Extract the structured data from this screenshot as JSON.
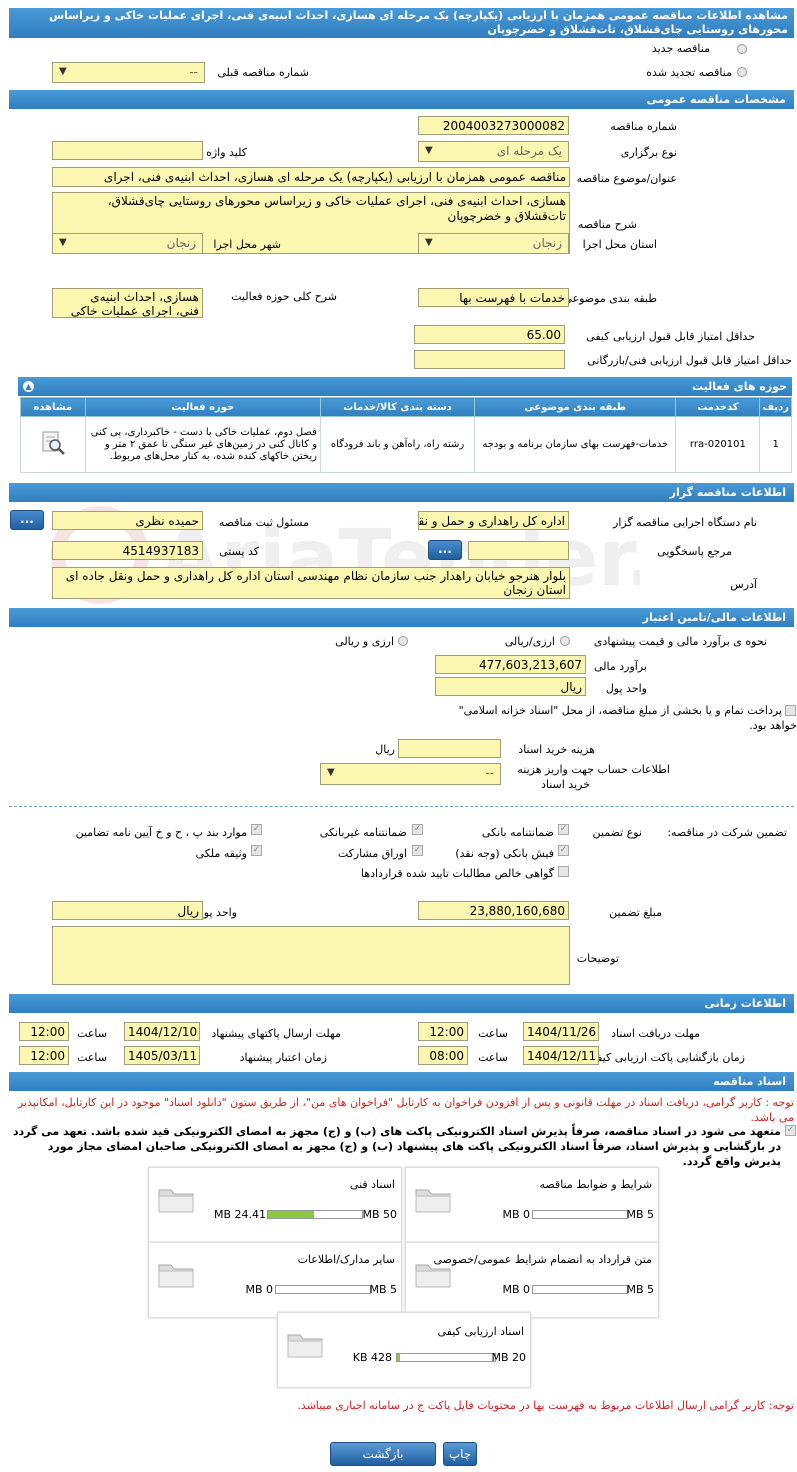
{
  "header": {
    "title_line1": "مشاهده اطلاعات مناقصه عمومی همزمان با ارزیابی (یکپارچه) یک مرحله ای هسازی، احداث ابنیه‌ی فنی، اجرای عملیات خاکی و زیراساس",
    "title_line2": "محورهای روستایی چای‌قشلاق، تات‌قشلاق و خضرچوپان"
  },
  "top": {
    "new_tender": "مناقصه جدید",
    "renewed_tender": "مناقصه تجدید شده",
    "prev_tender_label": "شماره مناقصه قبلی",
    "prev_tender_value": "--"
  },
  "general": {
    "section_title": "مشخصات مناقصه عمومی",
    "number_label": "شماره مناقصه",
    "number_value": "2004003273000082",
    "type_label": "نوع برگزاری",
    "type_value": "یک مرحله ای",
    "keyword_label": "کلید واژه",
    "keyword_value": "",
    "subject_label": "عنوان/موضوع مناقصه",
    "subject_value": "مناقصه عمومی همزمان با ارزیابی (یکپارچه) یک مرحله ای هسازی، احداث ابنیه‌ی فنی، اجرای",
    "desc_label": "شرح مناقصه",
    "desc_value": "هسازی، احداث ابنیه‌ی فنی، اجرای عملیات خاکی و زیراساس محورهای روستایی چای‌قشلاق، تات‌قشلاق و خضرچوپان",
    "province_label": "استان محل اجرا",
    "province_value": "زنجان",
    "city_label": "شهر محل اجرا",
    "city_value": "زنجان",
    "category_label": "طبقه بندی موضوعی",
    "category_value": "خدمات با فهرست بها",
    "scope_label": "شرح کلی حوزه فعالیت",
    "scope_value": "هسازی، احداث ابنیه‌ی فنی، اجرای عملیات خاکی",
    "min_quality_label": "حداقل امتیاز قابل قبول ارزیابی کیفی",
    "min_quality_value": "65.00",
    "min_tech_label": "حداقل امتیاز قابل قبول ارزیابی فنی/بازرگانی",
    "min_tech_value": ""
  },
  "activities": {
    "section_title": "حوزه های فعالیت",
    "columns": [
      "ردیف",
      "کدخدمت",
      "طبقه بندی موضوعی",
      "دسته بندی کالا/خدمات",
      "حوزه فعالیت",
      "مشاهده"
    ],
    "rows": [
      {
        "row": "1",
        "code": "rra-020101",
        "category": "خدمات-فهرست بهای سازمان برنامه و بودجه",
        "group": "رشته راه، راه‌آهن و باند فرودگاه",
        "activity": "فصل دوم، عملیات خاکی با دست - خاکبرداری، پی کنی و کانال کنی در زمین‌های غیر سنگی تا عمق ۲ متر و ریختن خاکهای کنده شده، به کنار محل‌های مربوط."
      }
    ]
  },
  "organizer": {
    "section_title": "اطلاعات مناقصه گزار",
    "org_label": "نام دستگاه اجرایی مناقصه گزار",
    "org_value": "اداره کل راهداری و حمل و نقل",
    "officer_label": "مسئول ثبت مناقصه",
    "officer_value": "حمیده نظری",
    "ref_label": "مرجع پاسخگویی",
    "ref_value": "",
    "postal_label": "کد پستی",
    "postal_value": "4514937183",
    "address_label": "آدرس",
    "address_value": "بلوار هنرجو خیابان راهدار جنب سازمان نظام مهندسی استان اداره کل راهداری و حمل ونقل جاده ای استان زنجان",
    "dots": "..."
  },
  "finance": {
    "section_title": "اطلاعات مالی/تامین اعتبار",
    "method_label": "نحوه ی برآورد مالی و قیمت پیشنهادی",
    "opt1": "ارزی/ریالی",
    "opt2": "ارزی و ریالی",
    "estimate_label": "برآورد مالی",
    "estimate_value": "477,603,213,607",
    "currency_label": "واحد پول",
    "currency_value": "ریال",
    "treasury_text1": "پرداخت تمام و یا بخشی از مبلغ مناقصه، از محل \"اسناد خزانه اسلامی\"",
    "treasury_text2": "خواهد بود.",
    "doc_cost_label": "هزینه خرید اسناد",
    "doc_cost_value": "",
    "doc_cost_unit": "ریال",
    "account_label1": "اطلاعات حساب جهت واریز هزینه",
    "account_label2": "خرید اسناد",
    "account_value": "--"
  },
  "guarantee": {
    "label": "تضمین شرکت در مناقصه:",
    "type_label": "نوع تضمین",
    "items": [
      "ضمانتنامه بانکی",
      "ضمانتنامه غیربانکی",
      "موارد بند پ ، ح و خ آیین نامه تضامین",
      "فیش بانکی (وجه نقد)",
      "اوراق مشارکت",
      "وثیقه ملکی",
      "گواهی خالص مطالبات تایید شده قراردادها"
    ],
    "amount_label": "مبلغ تضمین",
    "amount_value": "23,880,160,680",
    "currency_label": "واحد پول",
    "currency_value": "ریال",
    "notes_label": "توضیحات",
    "notes_value": ""
  },
  "timing": {
    "section_title": "اطلاعات زمانی",
    "receive_label": "مهلت دریافت اسناد",
    "receive_date": "1404/11/26",
    "receive_time": "12:00",
    "send_label": "مهلت ارسال پاکتهای پیشنهاد",
    "send_date": "1404/12/10",
    "send_time": "12:00",
    "open_label": "زمان بازگشایی پاکت ارزیابی کیفی",
    "open_date": "1404/12/11",
    "open_time": "08:00",
    "valid_label": "زمان اعتبار پیشنهاد",
    "valid_date": "1405/03/11",
    "valid_time": "12:00",
    "time_label": "ساعت"
  },
  "documents": {
    "section_title": "اسناد مناقصه",
    "note1": "توجه : کاربر گرامی، دریافت اسناد در مهلت قانونی و پس از افزودن فراخوان به کارتابل \"فراخوان های من\"، از طریق ستون \"دانلود اسناد\" موجود در این کارتابل، امکانپذیر می باشد.",
    "commit": "متعهد می شود در اسناد مناقصه، صرفاً پذیرش اسناد الکترونیکی پاکت های (ب) و (ج) مجهز به امضای الکترونیکی قید شده باشد. تعهد می گردد در بازگشایی و پذیرش اسناد، صرفاً اسناد الکترونیکی پاکت های پیشنهاد (ب) و (ج) مجهز به امضای الکترونیکی صاحبان امضای مجاز مورد پذیرش واقع گردد.",
    "cards": [
      {
        "title": "شرایط و ضوابط مناقصه",
        "used": "0 MB",
        "max": "5 MB",
        "fill": 0
      },
      {
        "title": "اسناد فنی",
        "used": "24.41 MB",
        "max": "50 MB",
        "fill": 0.49
      },
      {
        "title": "متن قرارداد به انضمام شرایط عمومی/خصوصی",
        "used": "0 MB",
        "max": "5 MB",
        "fill": 0
      },
      {
        "title": "سایر مدارک/اطلاعات",
        "used": "0 MB",
        "max": "5 MB",
        "fill": 0
      },
      {
        "title": "اسناد ارزیابی کیفی",
        "used": "428 KB",
        "max": "20 MB",
        "fill": 0.02
      }
    ],
    "note2": "توجه: کاربر گرامی ارسال اطلاعات مربوط به فهرست بها در محتویات فایل پاکت ج در سامانه اجباری میباشد."
  },
  "footer": {
    "print": "چاپ",
    "back": "بازگشت"
  }
}
